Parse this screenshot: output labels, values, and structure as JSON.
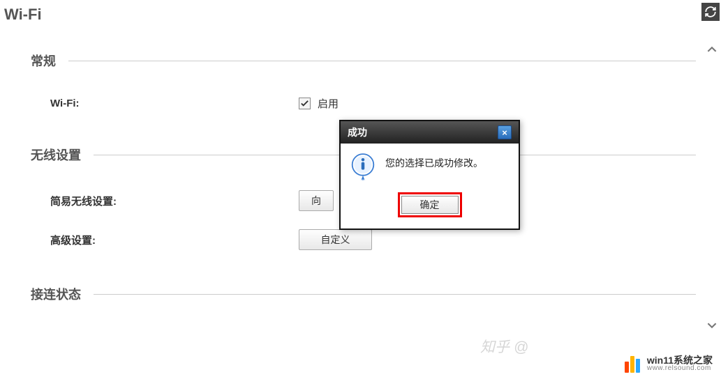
{
  "page_title": "Wi-Fi",
  "sections": {
    "general": {
      "title": "常规",
      "wifi": {
        "label": "Wi-Fi:",
        "enable_text": "启用",
        "checked": true
      }
    },
    "wireless": {
      "title": "无线设置",
      "simple": {
        "label": "简易无线设置:",
        "button": "向"
      },
      "advanced": {
        "label": "高级设置:",
        "button": "自定义"
      }
    },
    "status": {
      "title": "接连状态"
    }
  },
  "dialog": {
    "title": "成功",
    "message": "您的选择已成功修改。",
    "ok": "确定",
    "close": "×"
  },
  "watermarks": {
    "zhihu": "知乎 @",
    "brand": "win11系统之家",
    "brand_url": "www.relsound.com"
  }
}
